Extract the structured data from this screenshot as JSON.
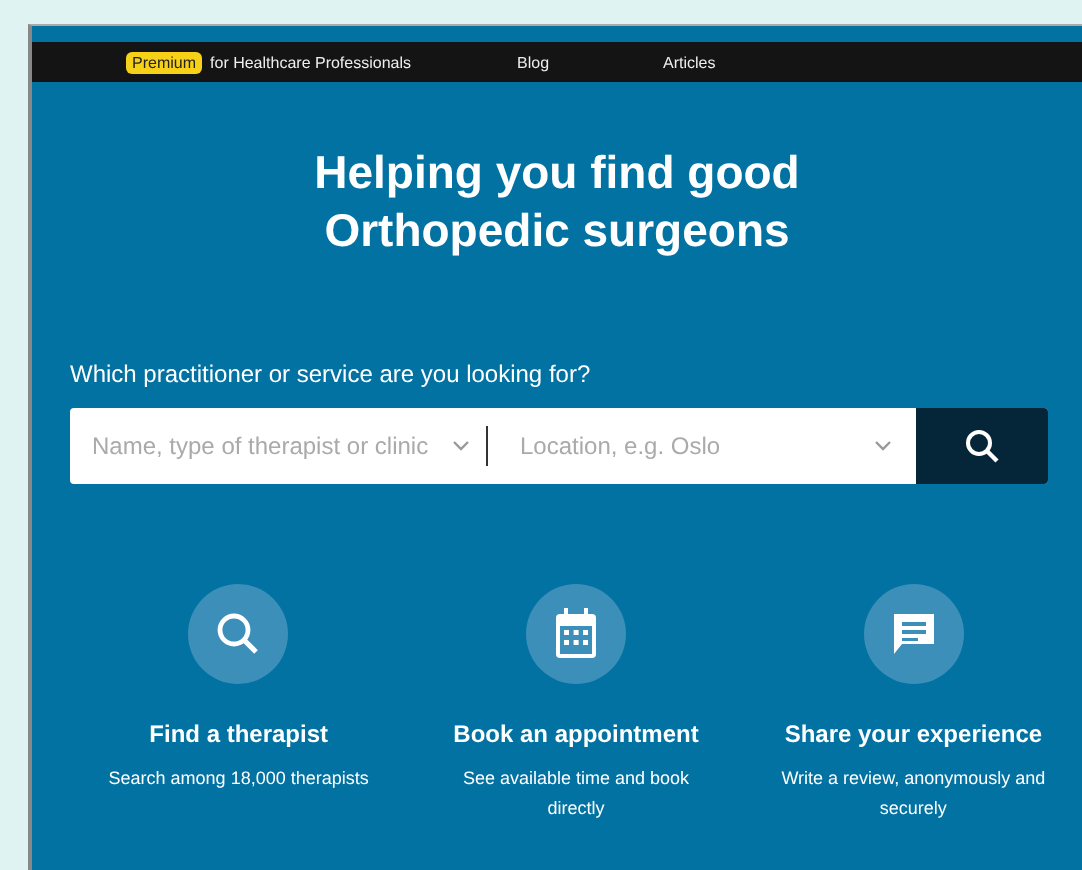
{
  "nav": {
    "badge": "Premium",
    "premium_link": "for Healthcare Professionals",
    "links": [
      "Blog",
      "Articles"
    ]
  },
  "hero": {
    "title_lines": [
      "Helping you find good",
      "Orthopedic surgeons"
    ]
  },
  "search": {
    "label": "Which practitioner or service are you looking for?",
    "what": {
      "placeholder": "Name, type of therapist or clinic"
    },
    "where": {
      "placeholder": "Location, e.g. Oslo"
    }
  },
  "features": [
    {
      "kind": "search",
      "title": "Find a therapist",
      "text": "Search among 18,000 therapists"
    },
    {
      "kind": "calendar",
      "title": "Book an appointment",
      "text": "See available time and book directly"
    },
    {
      "kind": "chat",
      "title": "Share your experience",
      "text": "Write a review, anonymously and securely"
    }
  ]
}
